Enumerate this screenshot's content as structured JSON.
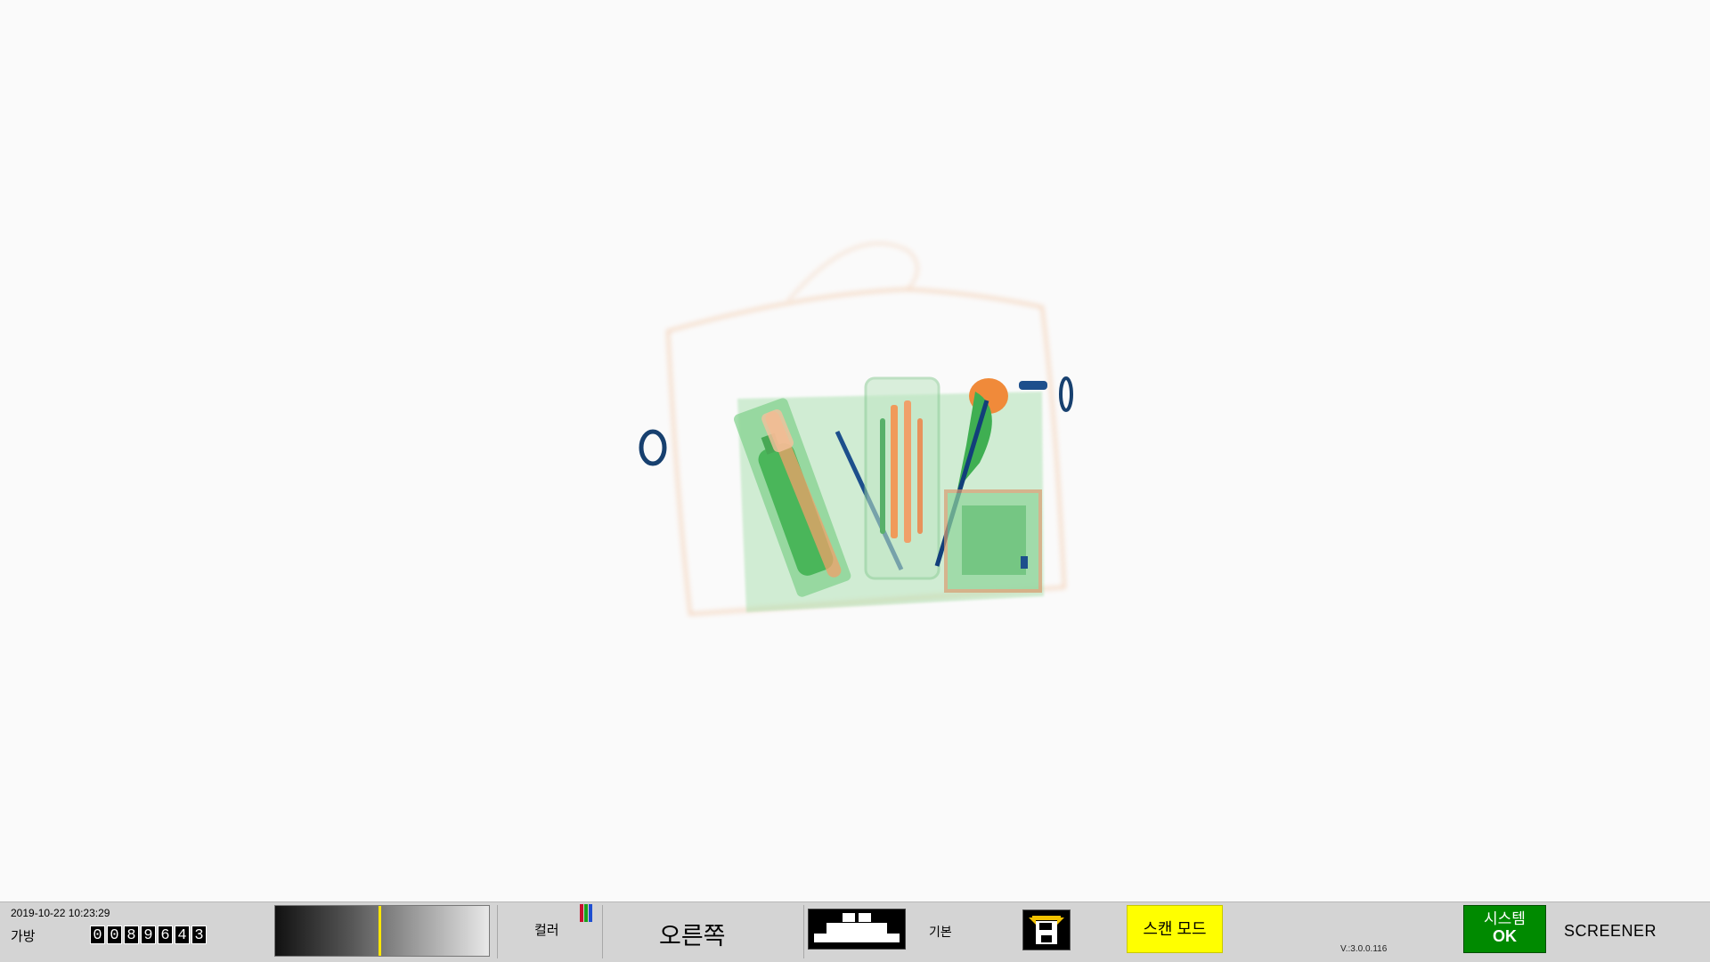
{
  "scan": {
    "image_description_name": "x-ray-bag-scan"
  },
  "statusbar": {
    "datetime": "2019-10-22 10:23:29",
    "bag_label": "가방",
    "bag_count_digits": [
      "0",
      "0",
      "8",
      "9",
      "6",
      "4",
      "3"
    ],
    "gradient_marker_fraction": 0.49,
    "color_label": "컬러",
    "color_bar_colors": [
      "#c8102e",
      "#1aa01a",
      "#1f4fd1"
    ],
    "side_label": "오른쪽",
    "mode_basic_label": "기본",
    "scan_mode_label": "스캔 모드",
    "version": "V.:3.0.0.116",
    "system_line1": "시스템",
    "system_line2": "OK",
    "operator_label": "SCREENER",
    "accent_yellow": "#ffff00",
    "status_green": "#008a00"
  }
}
